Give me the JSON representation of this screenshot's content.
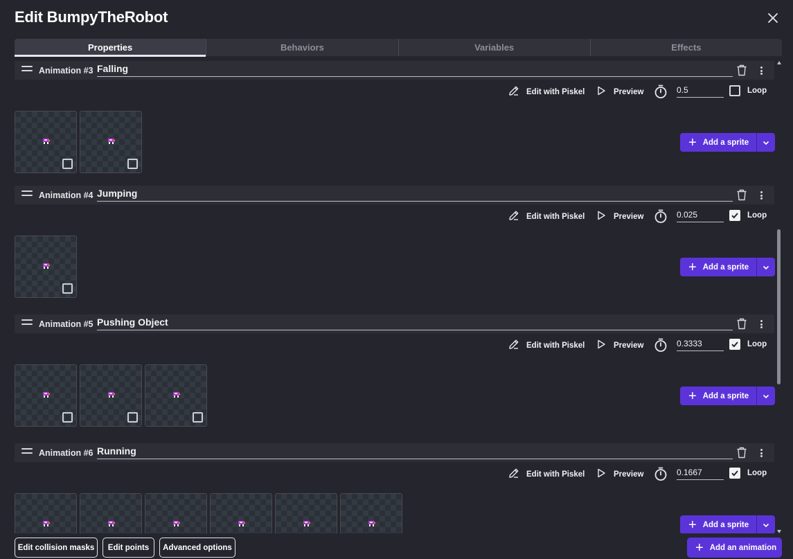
{
  "dialog": {
    "title": "Edit BumpyTheRobot",
    "close_icon": "close-icon"
  },
  "tabs": [
    {
      "label": "Properties",
      "active": true
    },
    {
      "label": "Behaviors",
      "active": false
    },
    {
      "label": "Variables",
      "active": false
    },
    {
      "label": "Effects",
      "active": false
    }
  ],
  "animations": [
    {
      "label": "Animation #3",
      "name": "Falling",
      "duration": "0.5",
      "loop": false,
      "sprite_count": 2
    },
    {
      "label": "Animation #4",
      "name": "Jumping",
      "duration": "0.025",
      "loop": true,
      "sprite_count": 1
    },
    {
      "label": "Animation #5",
      "name": "Pushing Object",
      "duration": "0.3333",
      "loop": true,
      "sprite_count": 3
    },
    {
      "label": "Animation #6",
      "name": "Running",
      "duration": "0.1667",
      "loop": true,
      "sprite_count": 6
    }
  ],
  "controls": {
    "edit_with_piskel": "Edit with Piskel",
    "preview": "Preview",
    "loop": "Loop",
    "add_sprite": "Add a sprite"
  },
  "footer": {
    "edit_collision_masks": "Edit collision masks",
    "edit_points": "Edit points",
    "advanced_options": "Advanced options",
    "add_animation": "Add an animation"
  },
  "colors": {
    "background": "#25252e",
    "accent": "#5b34d9",
    "header_bar": "#2e2e37"
  }
}
